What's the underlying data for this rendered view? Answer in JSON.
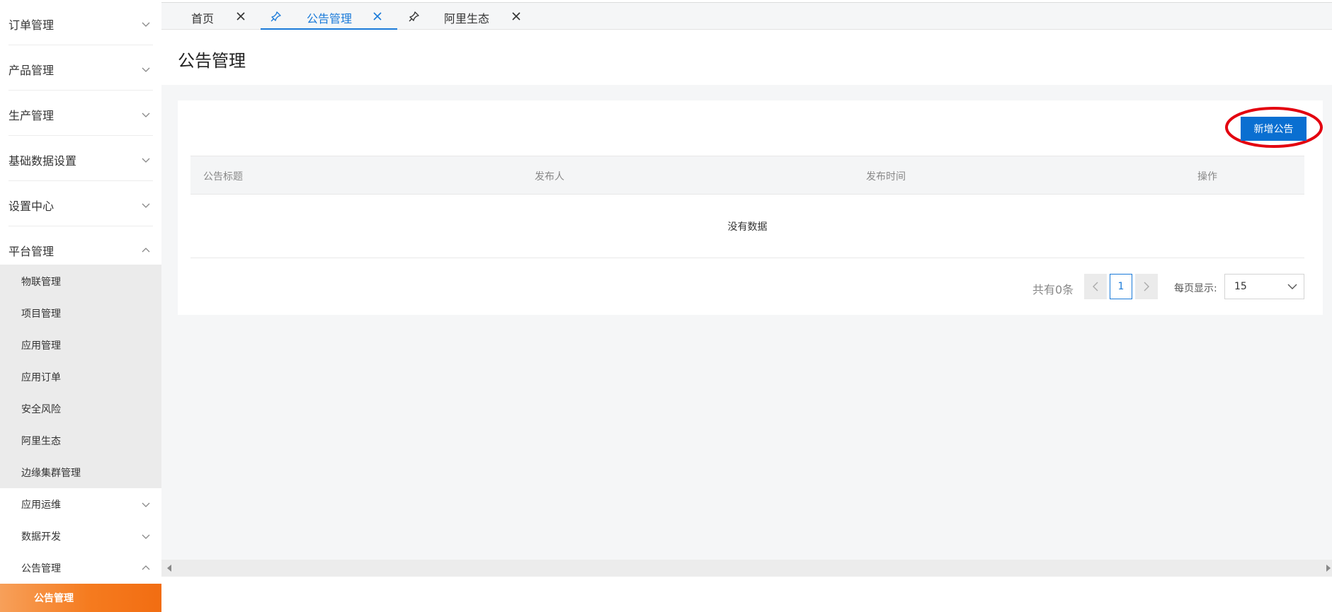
{
  "sidebar": {
    "groups": [
      {
        "label": "订单管理",
        "expanded": false
      },
      {
        "label": "产品管理",
        "expanded": false
      },
      {
        "label": "生产管理",
        "expanded": false
      },
      {
        "label": "基础数据设置",
        "expanded": false
      },
      {
        "label": "设置中心",
        "expanded": false
      },
      {
        "label": "平台管理",
        "expanded": true
      }
    ],
    "platform_items": [
      "物联管理",
      "项目管理",
      "应用管理",
      "应用订单",
      "安全风险",
      "阿里生态",
      "边缘集群管理"
    ],
    "sub_groups": [
      {
        "label": "应用运维",
        "expanded": false
      },
      {
        "label": "数据开发",
        "expanded": false
      },
      {
        "label": "公告管理",
        "expanded": true
      }
    ],
    "active_item": "公告管理"
  },
  "tabs": [
    {
      "label": "首页",
      "active": false,
      "pinned": false
    },
    {
      "label": "公告管理",
      "active": true,
      "pinned": true
    },
    {
      "label": "阿里生态",
      "active": false,
      "pinned": true
    }
  ],
  "page": {
    "title": "公告管理",
    "new_button": "新增公告",
    "table": {
      "columns": [
        "公告标题",
        "发布人",
        "发布时间",
        "操作"
      ],
      "empty_text": "没有数据"
    },
    "pagination": {
      "total_text": "共有0条",
      "current_page": "1",
      "per_page_label": "每页显示:",
      "per_page_value": "15"
    }
  },
  "colors": {
    "accent_blue": "#1a7ad9",
    "button_blue": "#0a6fd1",
    "active_orange": "#f57b1f",
    "highlight_red": "#e3000f"
  }
}
